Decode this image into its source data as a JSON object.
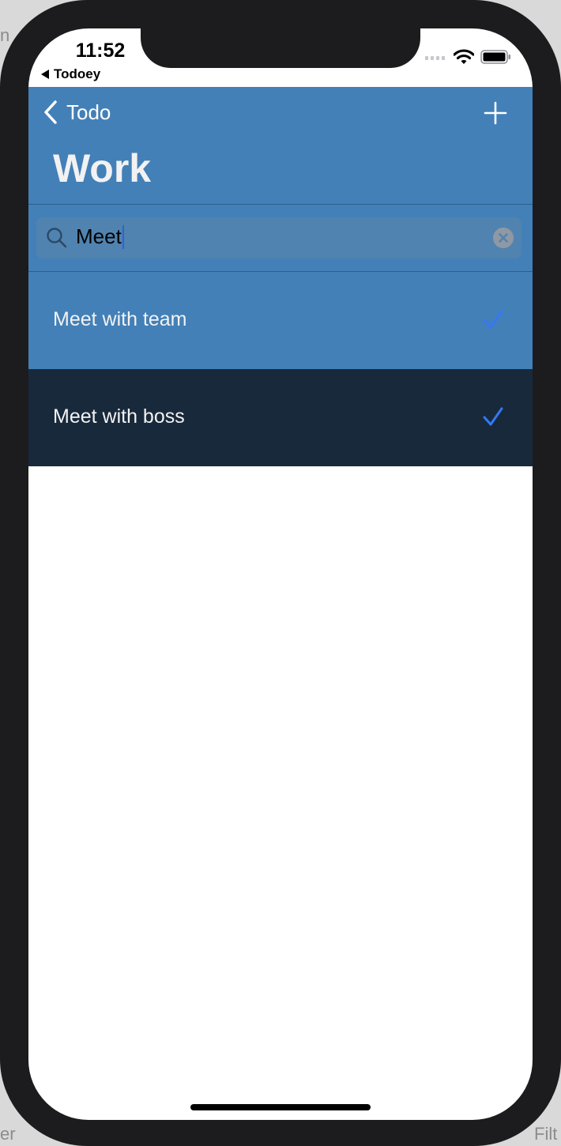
{
  "colors": {
    "nav_bg": "#4380b8",
    "row_1_bg": "#4380b8",
    "row_2_bg": "#19293c",
    "checkmark": "#3478f6",
    "text_light": "#f2f2f2"
  },
  "status_bar": {
    "time": "11:52",
    "back_app": "Todoey",
    "icons": [
      "cellular-signal-icon",
      "wifi-icon",
      "battery-icon"
    ]
  },
  "nav": {
    "back_label": "Todo",
    "back_icon": "chevron-left-icon",
    "add_icon": "plus-icon",
    "title": "Work"
  },
  "search": {
    "value": "Meet",
    "icon": "search-icon",
    "clear_icon": "clear-icon"
  },
  "items": [
    {
      "label": "Meet with team",
      "done": true
    },
    {
      "label": "Meet with boss",
      "done": true
    }
  ],
  "background": {
    "left_top": "n",
    "left_bottom": "er",
    "right_bottom": "Filt"
  }
}
